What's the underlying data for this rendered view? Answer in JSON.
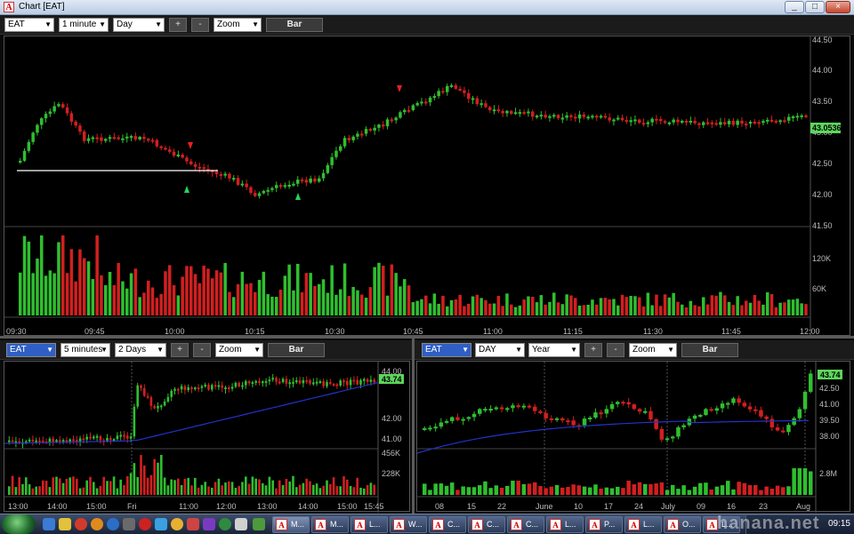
{
  "window": {
    "title": "Chart [EAT]",
    "app_icon": "A",
    "controls": [
      "_",
      "□",
      "×"
    ]
  },
  "main_chart": {
    "toolbar": {
      "symbol": "EAT",
      "interval": "1 minute",
      "period": "Day",
      "plus": "+",
      "minus": "-",
      "zoom": "Zoom",
      "style": "Bar"
    },
    "y_labels": [
      "44.50",
      "44.00",
      "43.50",
      "43.00",
      "42.50",
      "42.00",
      "41.50"
    ],
    "last_price": "43.0536",
    "vol_labels": [
      "120K",
      "60K"
    ],
    "x_labels": [
      "09:30",
      "09:45",
      "10:00",
      "10:15",
      "10:30",
      "10:45",
      "11:00",
      "11:15",
      "11:30",
      "11:45",
      "12:00"
    ]
  },
  "left_chart": {
    "toolbar": {
      "symbol": "EAT",
      "interval": "5 minutes",
      "period": "2 Days",
      "plus": "+",
      "minus": "-",
      "zoom": "Zoom",
      "style": "Bar"
    },
    "y_labels": [
      "44.00",
      "42.00",
      "41.00"
    ],
    "last_price": "43.74",
    "vol_labels": [
      "456K",
      "228K"
    ],
    "x_labels": [
      "13:00",
      "14:00",
      "15:00",
      "Fri",
      "11:00",
      "12:00",
      "13:00",
      "14:00",
      "15:00",
      "15:45"
    ]
  },
  "right_chart": {
    "toolbar": {
      "symbol": "EAT",
      "interval": "DAY",
      "period": "Year",
      "plus": "+",
      "minus": "-",
      "zoom": "Zoom",
      "style": "Bar"
    },
    "y_labels": [
      "42.50",
      "41.00",
      "39.50",
      "38.00"
    ],
    "last_price": "43.74",
    "vol_labels": [
      "2.8M"
    ],
    "x_labels": [
      "08",
      "15",
      "22",
      "June",
      "10",
      "17",
      "24",
      "July",
      "09",
      "16",
      "23",
      "Aug"
    ]
  },
  "colors": {
    "up": "#2fbf2f",
    "down": "#d21f1f",
    "avg_line": "#2233cc",
    "support_line": "#ffffff",
    "last_price_bg": "#5cd65c",
    "bg": "#000000"
  },
  "taskbar": {
    "items": [
      "M...",
      "M...",
      "L...",
      "W...",
      "C...",
      "C...",
      "C...",
      "L...",
      "P...",
      "L...",
      "O...",
      "L..."
    ],
    "clock": "09:15"
  },
  "watermark": "hanana.net"
}
